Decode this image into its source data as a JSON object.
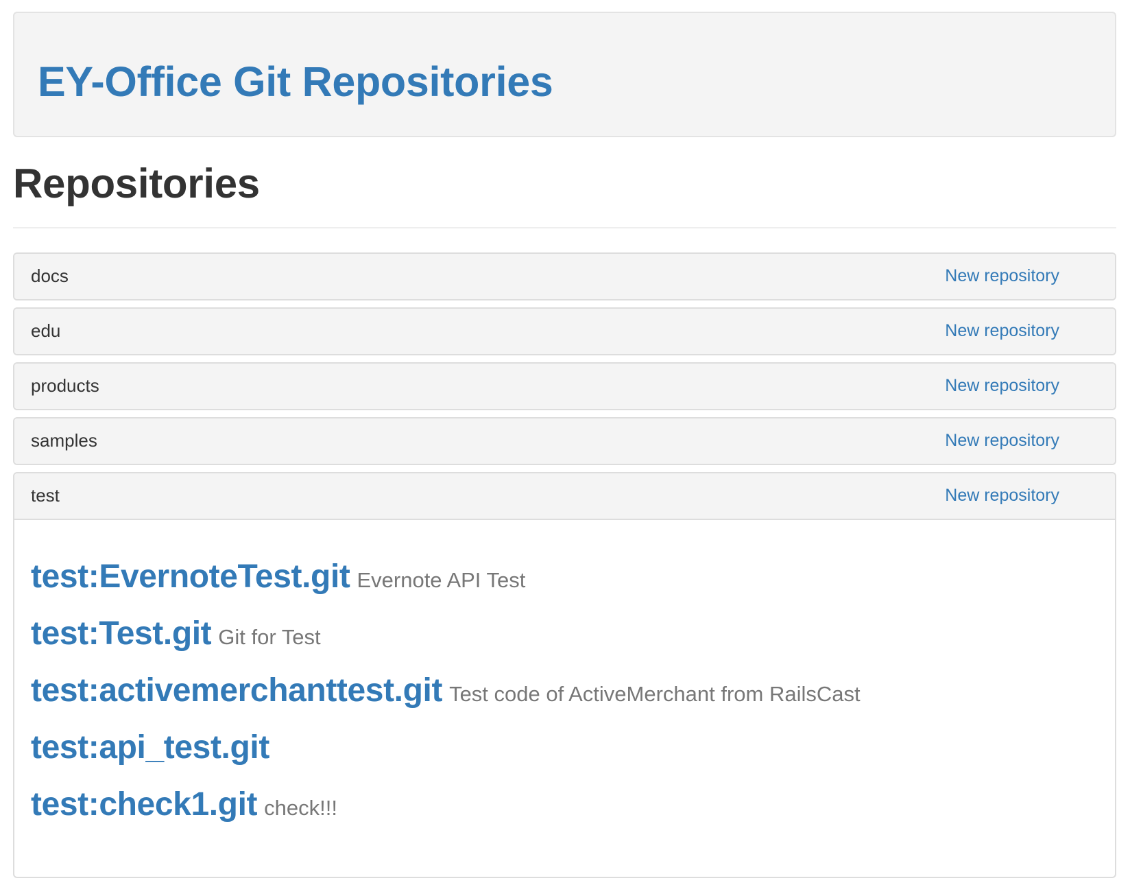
{
  "header": {
    "title": "EY-Office Git Repositories"
  },
  "section": {
    "title": "Repositories"
  },
  "groups": [
    {
      "name": "docs",
      "new_label": "New repository"
    },
    {
      "name": "edu",
      "new_label": "New repository"
    },
    {
      "name": "products",
      "new_label": "New repository"
    },
    {
      "name": "samples",
      "new_label": "New repository"
    },
    {
      "name": "test",
      "new_label": "New repository",
      "repositories": [
        {
          "name": "test:EvernoteTest.git",
          "description": "Evernote API Test"
        },
        {
          "name": "test:Test.git",
          "description": "Git for Test"
        },
        {
          "name": "test:activemerchanttest.git",
          "description": "Test code of ActiveMerchant from RailsCast"
        },
        {
          "name": "test:api_test.git",
          "description": ""
        },
        {
          "name": "test:check1.git",
          "description": "check!!!"
        }
      ]
    }
  ]
}
